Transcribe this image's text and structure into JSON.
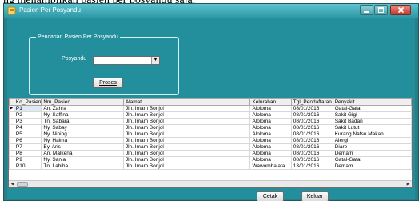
{
  "caption_fragment": "ng menampilkan pasien per posyandu saja.",
  "window": {
    "title": "Pasien Per Posyandu",
    "controls": [
      "minimize",
      "maximize",
      "close"
    ]
  },
  "form": {
    "group_title": "Pencarian Pasien Per Posyandu",
    "posyandu_label": "Posyandu",
    "posyandu_value": "",
    "proses_label": "Proses"
  },
  "grid": {
    "columns": [
      "Kd_Pasien",
      "Nm_Pasien",
      "Alamat",
      "Kelurahan",
      "Tgl_Pendaftaran",
      "Penyakit"
    ],
    "rows": [
      [
        "P1",
        "An. Zahra",
        "Jln. Imam Bonjol",
        "Aloloma",
        "08/01/2016",
        "Gatal-Gatal"
      ],
      [
        "P2",
        "Ny. Saffina",
        "Jln. Imam Bonjol",
        "Aloloma",
        "08/01/2016",
        "Sakit Gigi"
      ],
      [
        "P3",
        "Tn. Sabara",
        "Jln. Imam Bonjol",
        "Aloloma",
        "08/01/2016",
        "Sakit Badan"
      ],
      [
        "P4",
        "Ny. Sabay",
        "Jln. Imam Bonjol",
        "Aloloma",
        "08/01/2016",
        "Sakit Lutut"
      ],
      [
        "P5",
        "Ny. Nining",
        "Jln. Imam Bonjol",
        "Aloloma",
        "08/01/2016",
        "Kurang Nafsu Makan"
      ],
      [
        "P6",
        "Ny. Halma",
        "Jln. Imam Bonjol",
        "Aloloma",
        "08/01/2016",
        "Alergi"
      ],
      [
        "P7",
        "By. Aris",
        "Jln. Imam Bonjol",
        "Aloloma",
        "08/01/2016",
        "Diare"
      ],
      [
        "P8",
        "An. Malkena",
        "Jln. Imam Bonjol",
        "Aloloma",
        "08/01/2016",
        "Demam"
      ],
      [
        "P9",
        "Ny. Sania",
        "Jln. Imam Bonjol",
        "Aloloma",
        "08/01/2016",
        "Gatal-Gatal"
      ],
      [
        "P10",
        "Tn. Labiha",
        "Jln. Imam Bonjol",
        "Wawombalata",
        "13/01/2016",
        "Demam"
      ]
    ],
    "selected_row": 0
  },
  "footer": {
    "cetak_label": "Cetak",
    "keluar_label": "Keluar"
  },
  "colors": {
    "client_bg": "#238f9c",
    "titlebar": "#3aa5b2",
    "close": "#c43b2b"
  }
}
